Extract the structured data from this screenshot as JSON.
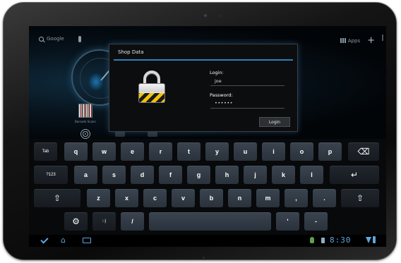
{
  "homescreen": {
    "search_label": "Google",
    "apps_label": "Apps",
    "add_label": "+",
    "barcode_widget_label": "Barcode Scann"
  },
  "dialog": {
    "title": "Shop Data",
    "login_label": "Login:",
    "login_value": "joe",
    "password_label": "Password:",
    "password_value": "••••••",
    "login_button": "Login"
  },
  "keyboard": {
    "row1": [
      "Tab",
      "q",
      "w",
      "e",
      "r",
      "t",
      "y",
      "u",
      "i",
      "o",
      "p",
      "⌫"
    ],
    "row2": [
      "?123",
      "a",
      "s",
      "d",
      "f",
      "g",
      "h",
      "j",
      "k",
      "l",
      "↵"
    ],
    "row3": [
      "⇧",
      "z",
      "x",
      "c",
      "v",
      "b",
      "n",
      "m",
      ",",
      ".",
      "⇧"
    ],
    "row4": [
      "⚙",
      ":-)",
      "/",
      "",
      "'",
      "-"
    ]
  },
  "status_bar": {
    "time": "8:30",
    "accent_color": "#5fa7dc"
  }
}
